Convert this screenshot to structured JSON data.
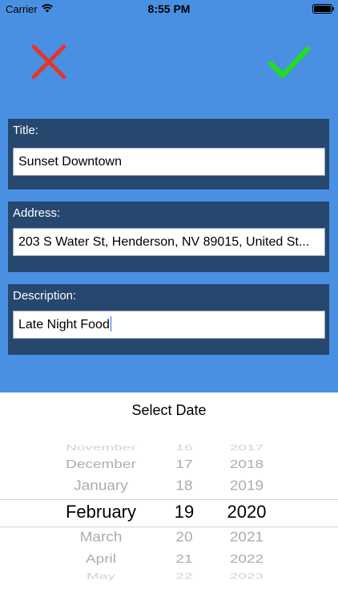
{
  "status_bar": {
    "carrier": "Carrier",
    "time": "8:55 PM",
    "wifi_icon": "wifi-icon",
    "battery_icon": "battery-full-icon"
  },
  "toolbar": {
    "cancel_icon": "x-mark-icon",
    "cancel_color": "#e8342a",
    "confirm_icon": "checkmark-icon",
    "confirm_color": "#22e014"
  },
  "colors": {
    "background": "#4a90e2",
    "panel": "#26476e"
  },
  "form": {
    "title": {
      "label": "Title:",
      "value": "Sunset Downtown"
    },
    "address": {
      "label": "Address:",
      "value": "203 S Water St, Henderson, NV 89015, United St..."
    },
    "description": {
      "label": "Description:",
      "value": "Late Night Food"
    }
  },
  "date_picker": {
    "title": "Select Date",
    "months": [
      "November",
      "December",
      "January",
      "February",
      "March",
      "April",
      "May"
    ],
    "days": [
      "16",
      "17",
      "18",
      "19",
      "20",
      "21",
      "22"
    ],
    "years": [
      "2017",
      "2018",
      "2019",
      "2020",
      "2021",
      "2022",
      "2023"
    ],
    "selected_month": "February",
    "selected_day": "19",
    "selected_year": "2020"
  }
}
